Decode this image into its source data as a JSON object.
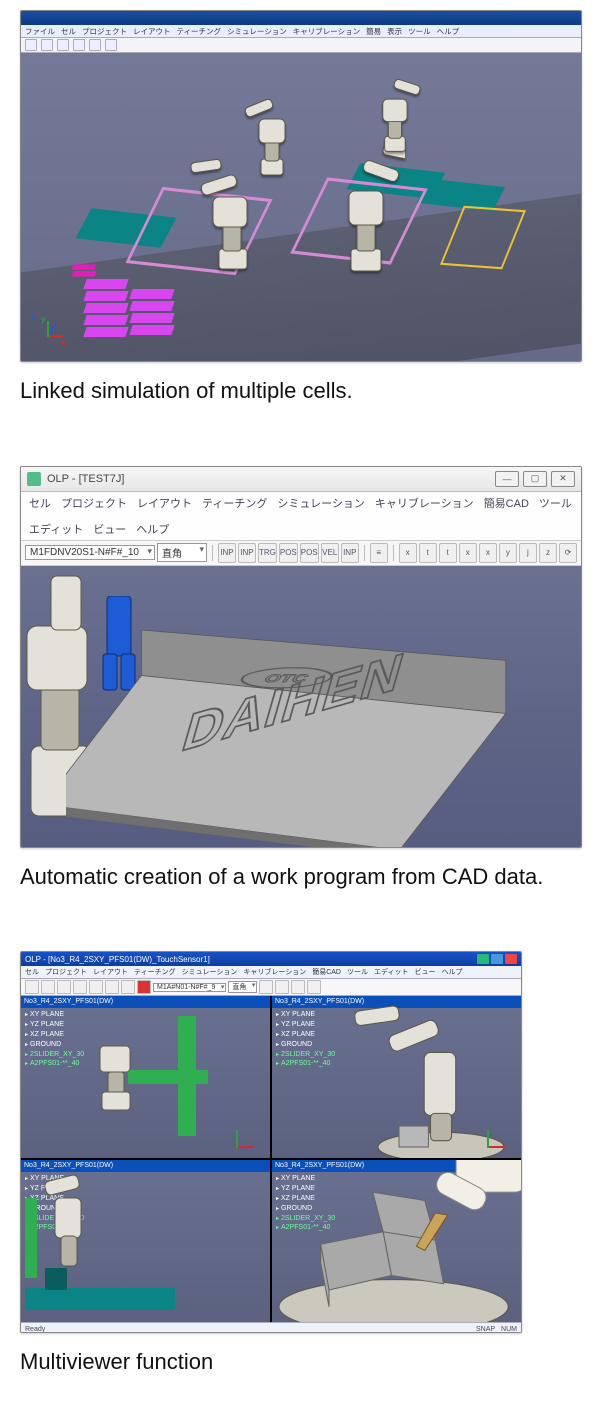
{
  "figures": [
    {
      "caption": "Linked simulation of multiple cells."
    },
    {
      "caption": "Automatic creation of a work program from CAD data."
    },
    {
      "caption": "Multiviewer function"
    }
  ],
  "screenshot1": {
    "menubar": [
      "ファイル",
      "セル",
      "プロジェクト",
      "レイアウト",
      "ティーチング",
      "シミュレーション",
      "キャリブレーション",
      "簡易",
      "表示",
      "ツール",
      "ヘルプ"
    ]
  },
  "screenshot2": {
    "window_title": "OLP - [TEST7J]",
    "window_buttons": {
      "min": "—",
      "max": "▢",
      "close": "✕"
    },
    "menubar": [
      "セル",
      "プロジェクト",
      "レイアウト",
      "ティーチング",
      "シミュレーション",
      "キャリブレーション",
      "簡易CAD",
      "ツール",
      "エディット",
      "ビュー",
      "ヘルプ"
    ],
    "dropdown1": "M1FDNV20S1-N#F#_10",
    "dropdown2": "直角",
    "toolbar_buttons": [
      "INP",
      "INP",
      "TRG",
      "POS",
      "POS",
      "VEL",
      "INP",
      "≡",
      "x",
      "t",
      "t",
      "x",
      "x",
      "y",
      "j",
      "z",
      "⟳"
    ],
    "engraving_logo": "OTC",
    "engraving_text": "DAIHEN"
  },
  "screenshot3": {
    "title": "OLP - [No3_R4_2SXY_PFS01(DW)_TouchSensor1]",
    "menubar": [
      "セル",
      "プロジェクト",
      "レイアウト",
      "ティーチング",
      "シミュレーション",
      "キャリブレーション",
      "簡易CAD",
      "ツール",
      "エディット",
      "ビュー",
      "ヘルプ"
    ],
    "toolbar_dd1": "M1A#N01-N#F#_9",
    "toolbar_dd2": "直角",
    "pane_header": "No3_R4_2SXY_PFS01(DW)",
    "tree": [
      "XY PLANE",
      "YZ PLANE",
      "XZ PLANE",
      "GROUND",
      "2SLIDER_XY_30",
      "A2PFS01-**_40"
    ],
    "status_left": "Ready",
    "status_right": [
      "SNAP",
      "NUM"
    ]
  }
}
